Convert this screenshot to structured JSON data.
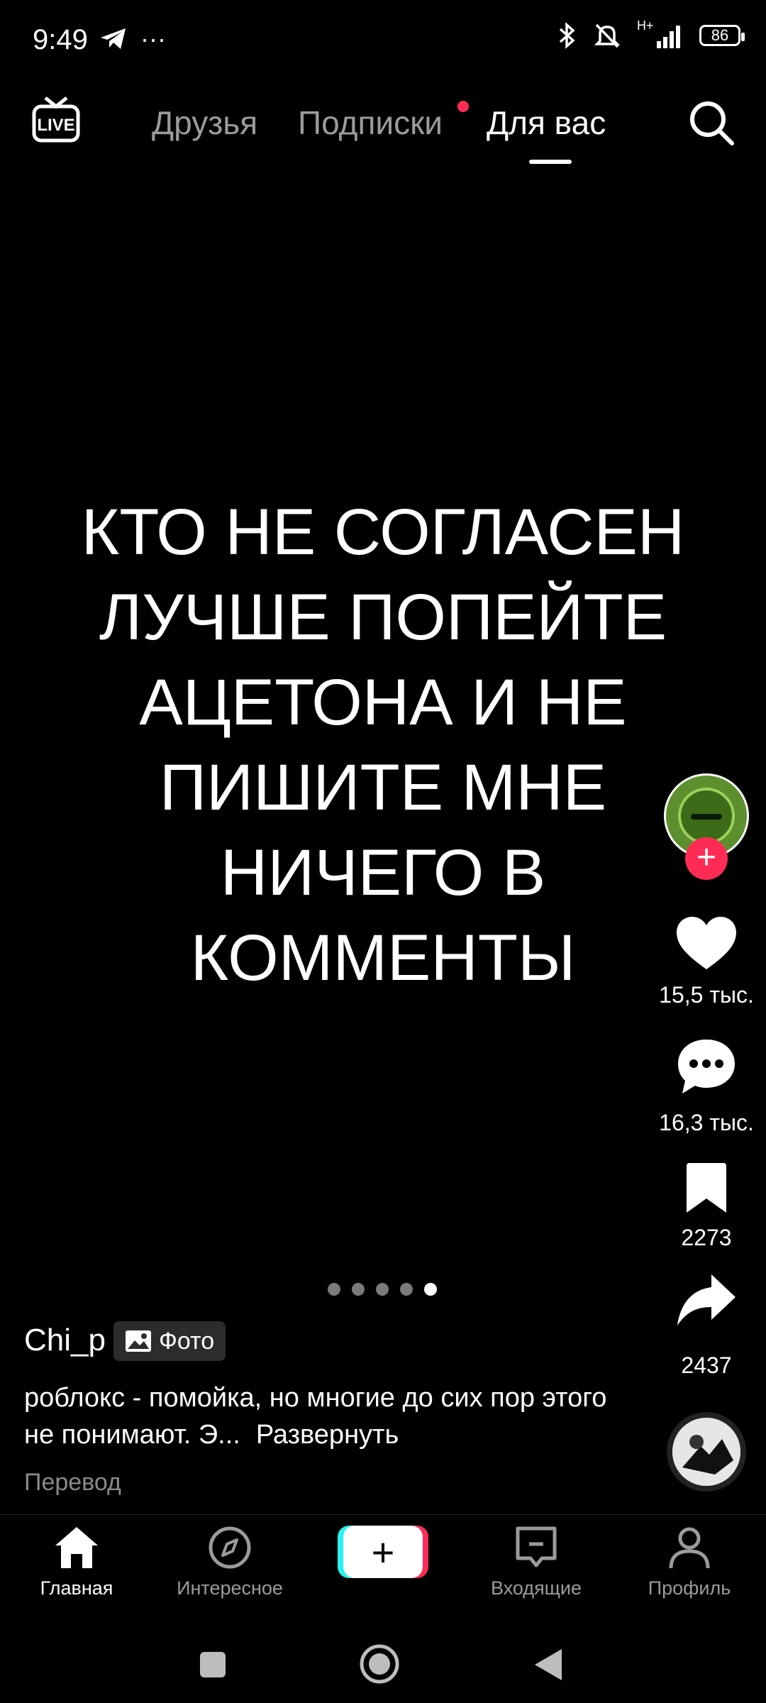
{
  "status_bar": {
    "time": "9:49",
    "battery": "86",
    "network": "H+"
  },
  "top_nav": {
    "tabs": [
      "Друзья",
      "Подписки",
      "Для вас"
    ],
    "active_tab": "Для вас"
  },
  "post": {
    "text": "КТО НЕ СОГЛАСЕН\nЛУЧШЕ ПОПЕЙТЕ\nАЦЕТОНА И НЕ\nПИШИТЕ МНЕ\nНИЧЕГО В\nКОММЕНТЫ",
    "username": "Chi_p",
    "badge": "Фото",
    "description": "роблокс - помойка, но многие до сих пор этого не понимают. Э...",
    "expand": "Развернуть",
    "translate": "Перевод",
    "carousel_total": 5,
    "carousel_index": 5
  },
  "actions": {
    "likes": "15,5 тыс.",
    "comments": "16,3 тыс.",
    "saves": "2273",
    "shares": "2437"
  },
  "bottom_tabs": {
    "home": "Главная",
    "discover": "Интересное",
    "inbox": "Входящие",
    "profile": "Профиль"
  },
  "colors": {
    "accent_red": "#fe2c55",
    "accent_cyan": "#25f4ee",
    "inactive_text": "#9b9b9b"
  }
}
